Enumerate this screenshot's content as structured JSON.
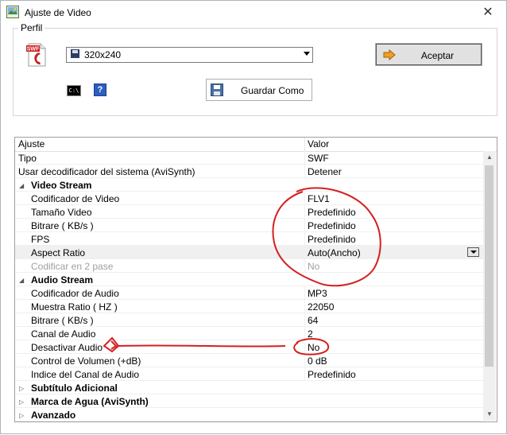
{
  "window": {
    "title": "Ajuste de Video",
    "close_symbol": "✕"
  },
  "perfil": {
    "legend": "Perfil",
    "selected_profile": "320x240",
    "accept_label": "Aceptar",
    "saveas_label": "Guardar Como",
    "swf_badge": "SWF",
    "cmd_icon_text": "C:\\",
    "help_icon_text": "?"
  },
  "grid": {
    "header": {
      "setting": "Ajuste",
      "value": "Valor"
    },
    "rows": [
      {
        "name": "Tipo",
        "value": "SWF"
      },
      {
        "name": "Usar decodificador del sistema (AviSynth)",
        "value": "Detener"
      },
      {
        "name": "Video Stream",
        "value": ""
      },
      {
        "name": "Codificador de Video",
        "value": "FLV1"
      },
      {
        "name": "Tamaño Video",
        "value": "Predefinido"
      },
      {
        "name": "Bitrare ( KB/s )",
        "value": "Predefinido"
      },
      {
        "name": "FPS",
        "value": "Predefinido"
      },
      {
        "name": "Aspect Ratio",
        "value": "Auto(Ancho)"
      },
      {
        "name": "Codificar en 2 pase",
        "value": "No"
      },
      {
        "name": "Audio Stream",
        "value": ""
      },
      {
        "name": "Codificador de Audio",
        "value": "MP3"
      },
      {
        "name": "Muestra Ratio ( HZ )",
        "value": "22050"
      },
      {
        "name": "Bitrare ( KB/s )",
        "value": "64"
      },
      {
        "name": "Canal de Audio",
        "value": "2"
      },
      {
        "name": "Desactivar Audio",
        "value": "No"
      },
      {
        "name": "Control de Volumen (+dB)",
        "value": "0 dB"
      },
      {
        "name": "Indice del Canal de Audio",
        "value": "Predefinido"
      },
      {
        "name": "Subtítulo Adicional",
        "value": ""
      },
      {
        "name": "Marca de Agua (AviSynth)",
        "value": ""
      },
      {
        "name": "Avanzado",
        "value": ""
      }
    ]
  },
  "colors": {
    "annotation": "#d42020",
    "accept_icon": "#f0a020"
  }
}
